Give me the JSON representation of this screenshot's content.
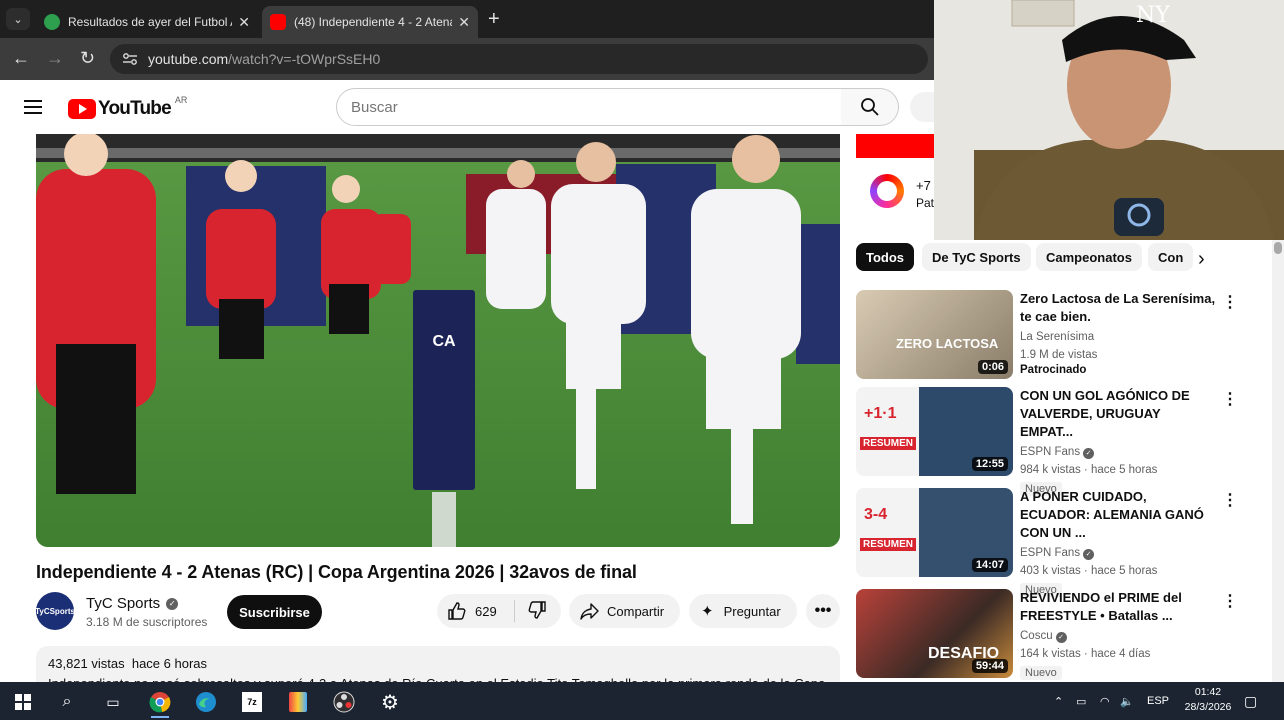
{
  "browser": {
    "tabs": [
      {
        "title": "Resultados de ayer del Futbol A",
        "active": false
      },
      {
        "title": "(48) Independiente 4 - 2 Atenas",
        "active": true
      }
    ],
    "new_tab": "+",
    "url_host": "youtube.com",
    "url_path": "/watch?v=-tOWprSsEH0"
  },
  "youtube": {
    "logo_text": "YouTube",
    "country": "AR",
    "search_placeholder": "Buscar"
  },
  "video": {
    "title": "Independiente 4 - 2 Atenas (RC) | Copa Argentina 2026 | 32avos de final",
    "channel": "TyC Sports",
    "channel_avatar_text": "TyCSports",
    "subscribers": "3.18 M de suscriptores",
    "subscribe_label": "Suscribirse",
    "likes": "629",
    "share_label": "Compartir",
    "ask_label": "Preguntar",
    "more_label": "•••",
    "views": "43,821 vistas",
    "published": "hace 6 horas",
    "description": "Independiente no pasó sobresaltos y superó 4-2 a Atenas de Río Cuarto en el Estadio Tito Tomaghello por la primera ronda de la Copa"
  },
  "ad": {
    "line1": "+7",
    "line2": "Pat"
  },
  "chips": [
    "Todos",
    "De TyC Sports",
    "Campeonatos",
    "Con"
  ],
  "recommendations": [
    {
      "title": "Zero Lactosa de La Serenísima, te cae bien.",
      "channel": "La Serenísima",
      "verified": false,
      "stats": "1.9 M de vistas",
      "badge": "",
      "sponsored": "Patrocinado",
      "duration": "0:06",
      "thumb_text": "ZERO LACTOSA"
    },
    {
      "title": "CON UN GOL AGÓNICO DE VALVERDE, URUGUAY EMPAT...",
      "channel": "ESPN Fans",
      "verified": true,
      "stats": "984 k vistas · hace 5 horas",
      "badge": "Nuevo",
      "sponsored": "",
      "duration": "12:55",
      "thumb_text": "+1·1",
      "thumb_sub": "RESUMEN"
    },
    {
      "title": "A PONER CUIDADO, ECUADOR: ALEMANIA GANÓ CON UN ...",
      "channel": "ESPN Fans",
      "verified": true,
      "stats": "403 k vistas · hace 5 horas",
      "badge": "Nuevo",
      "sponsored": "",
      "duration": "14:07",
      "thumb_text": "3-4",
      "thumb_sub": "RESUMEN"
    },
    {
      "title": "REVIVIENDO el PRIME del FREESTYLE • Batallas ...",
      "channel": "Coscu",
      "verified": true,
      "stats": "164 k vistas · hace 4 días",
      "badge": "Nuevo",
      "sponsored": "",
      "duration": "59:44",
      "thumb_text": "DESAFIO"
    }
  ],
  "taskbar": {
    "lang": "ESP",
    "time": "01:42",
    "date": "28/3/2026"
  },
  "colors": {
    "yt_red": "#ff0000",
    "chrome_dark": "#1f1f1f",
    "taskbar": "#1c2432"
  }
}
